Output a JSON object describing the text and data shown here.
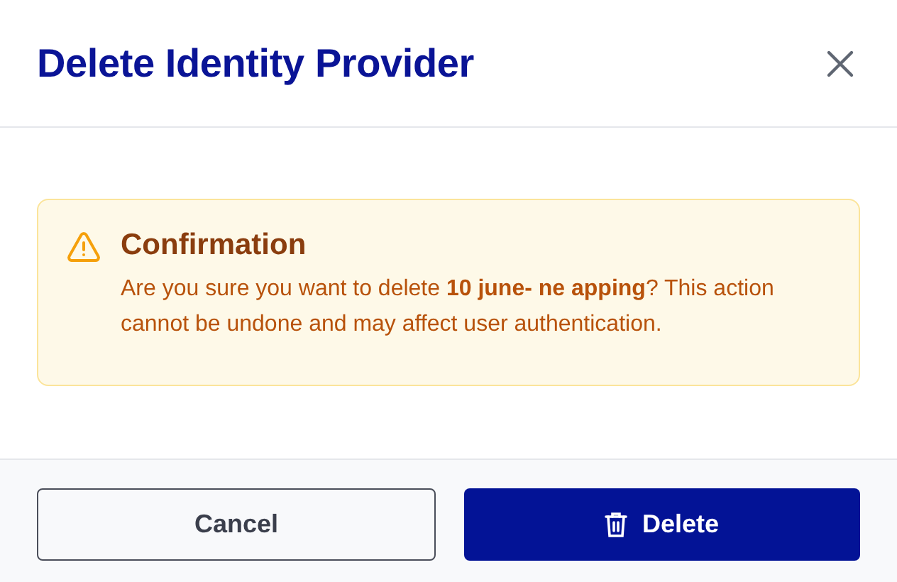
{
  "dialog": {
    "title": "Delete Identity Provider"
  },
  "alert": {
    "title": "Confirmation",
    "message": "Are you sure you want to delete **10 june- ne apping**? This action cannot be undone and may affect user authentication."
  },
  "buttons": [
    {
      "label": "Cancel",
      "kind": "secondary"
    },
    {
      "label": "Delete",
      "kind": "primary"
    }
  ]
}
